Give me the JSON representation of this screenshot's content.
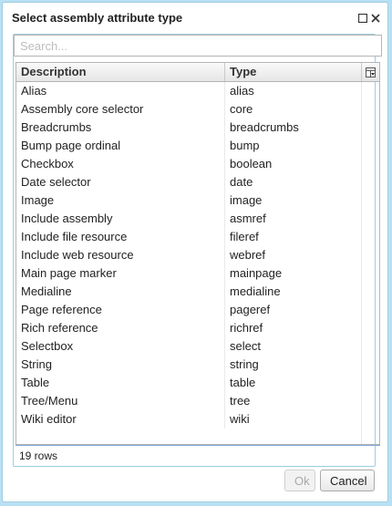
{
  "dialog": {
    "title": "Select assembly attribute type",
    "search_placeholder": "Search...",
    "columns": {
      "description": "Description",
      "type": "Type"
    },
    "rows": [
      {
        "description": "Alias",
        "type": "alias"
      },
      {
        "description": "Assembly core selector",
        "type": "core"
      },
      {
        "description": "Breadcrumbs",
        "type": "breadcrumbs"
      },
      {
        "description": "Bump page ordinal",
        "type": "bump"
      },
      {
        "description": "Checkbox",
        "type": "boolean"
      },
      {
        "description": "Date selector",
        "type": "date"
      },
      {
        "description": "Image",
        "type": "image"
      },
      {
        "description": "Include assembly",
        "type": "asmref"
      },
      {
        "description": "Include file resource",
        "type": "fileref"
      },
      {
        "description": "Include web resource",
        "type": "webref"
      },
      {
        "description": "Main page marker",
        "type": "mainpage"
      },
      {
        "description": "Medialine",
        "type": "medialine"
      },
      {
        "description": "Page reference",
        "type": "pageref"
      },
      {
        "description": "Rich reference",
        "type": "richref"
      },
      {
        "description": "Selectbox",
        "type": "select"
      },
      {
        "description": "String",
        "type": "string"
      },
      {
        "description": "Table",
        "type": "table"
      },
      {
        "description": "Tree/Menu",
        "type": "tree"
      },
      {
        "description": "Wiki editor",
        "type": "wiki"
      }
    ],
    "row_count_label": "19 rows",
    "ok_label": "Ok",
    "cancel_label": "Cancel"
  }
}
